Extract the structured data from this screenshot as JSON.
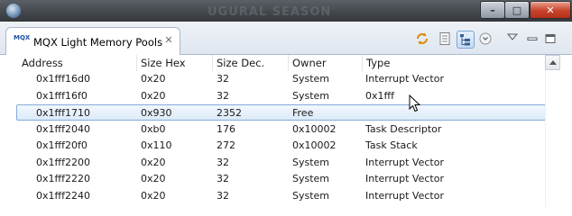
{
  "window": {
    "background_title": "UGURAL SEASON",
    "minimize_label": "–",
    "maximize_label": "□",
    "close_label": "✕"
  },
  "view": {
    "tab_title": "MQX Light Memory Pools",
    "icon_text": "MQX",
    "close_glyph": "✕"
  },
  "toolbar": {
    "refresh_icon": "refresh-icon",
    "document_icon": "document-icon",
    "tree_icon": "tree-layout-icon",
    "navigate_icon": "navigate-icon",
    "view_menu_glyph": "▽"
  },
  "table": {
    "columns": [
      "Address",
      "Size Hex",
      "Size Dec.",
      "Owner",
      "Type"
    ],
    "rows": [
      [
        "0x1fff16d0",
        "0x20",
        "32",
        "System",
        "Interrupt Vector"
      ],
      [
        "0x1fff16f0",
        "0x20",
        "32",
        "System",
        "0x1fff"
      ],
      [
        "0x1fff1710",
        "0x930",
        "2352",
        "Free",
        ""
      ],
      [
        "0x1fff2040",
        "0xb0",
        "176",
        "0x10002",
        "Task Descriptor"
      ],
      [
        "0x1fff20f0",
        "0x110",
        "272",
        "0x10002",
        "Task Stack"
      ],
      [
        "0x1fff2200",
        "0x20",
        "32",
        "System",
        "Interrupt Vector"
      ],
      [
        "0x1fff2220",
        "0x20",
        "32",
        "System",
        "Interrupt Vector"
      ],
      [
        "0x1fff2240",
        "0x20",
        "32",
        "System",
        "Interrupt Vector"
      ]
    ],
    "selected_row": 2
  },
  "colors": {
    "selection_border": "#84acd9",
    "header_divider": "#e2e5ea",
    "close_button": "#c9432a"
  }
}
